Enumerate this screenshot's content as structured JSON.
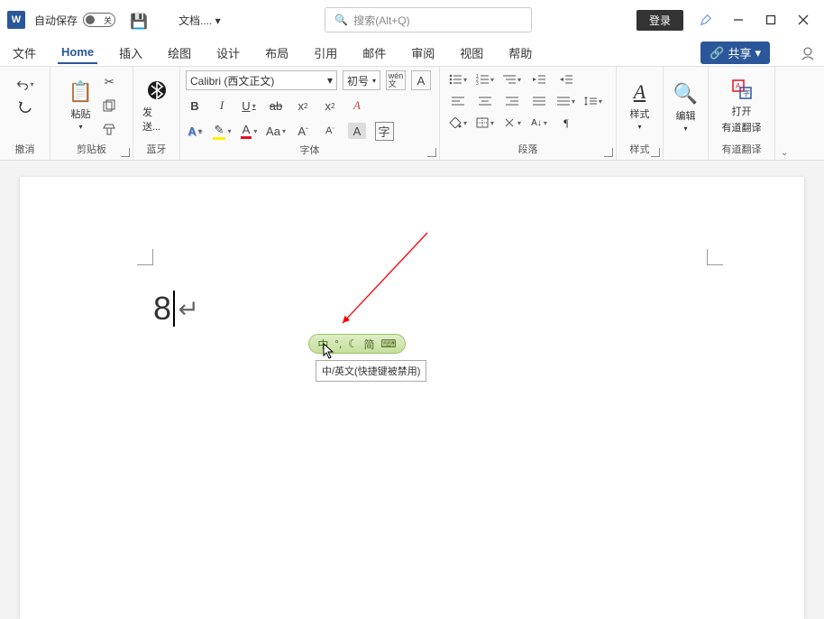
{
  "titlebar": {
    "app_letter": "W",
    "autosave_label": "自动保存",
    "toggle_state": "关",
    "doc_name": "文档.... ▾",
    "search_placeholder": "搜索(Alt+Q)",
    "login_label": "登录"
  },
  "menu": {
    "tabs": [
      "文件",
      "Home",
      "插入",
      "绘图",
      "设计",
      "布局",
      "引用",
      "邮件",
      "审阅",
      "视图",
      "帮助"
    ],
    "active_index": 1,
    "share_label": "共享"
  },
  "ribbon": {
    "undo": {
      "label": "撤消"
    },
    "clipboard": {
      "paste_label": "粘贴",
      "group_label": "剪贴板"
    },
    "bluetooth": {
      "send_label": "发送...",
      "group_label": "蓝牙"
    },
    "font": {
      "font_name": "Calibri (西文正文)",
      "font_size": "初号",
      "group_label": "字体"
    },
    "paragraph": {
      "group_label": "段落"
    },
    "styles": {
      "label": "样式",
      "group_label": "样式"
    },
    "edit": {
      "label": "编辑"
    },
    "translate": {
      "line1": "打开",
      "line2": "有道翻译",
      "group_label": "有道翻译"
    }
  },
  "document": {
    "text": "8"
  },
  "ime": {
    "pill": {
      "cn": "中",
      "sym": "°,",
      "moon": "☾",
      "simp": "简",
      "kbd": "⌨"
    },
    "tooltip": "中/英文(快捷键被禁用)"
  }
}
